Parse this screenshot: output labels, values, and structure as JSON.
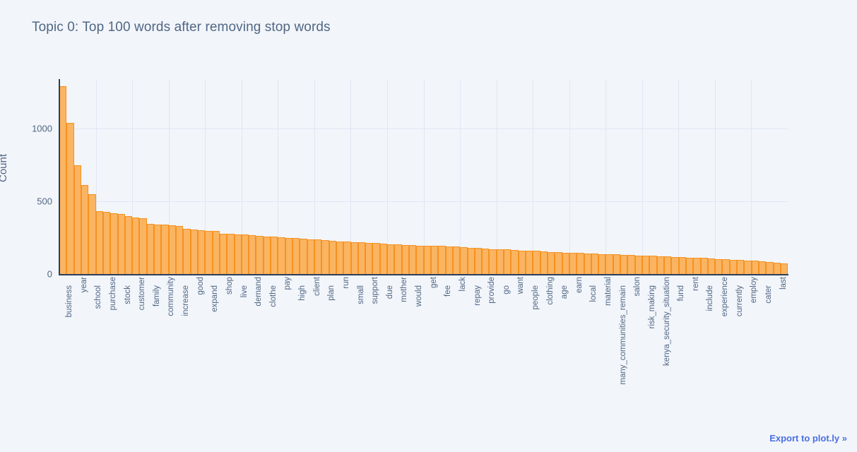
{
  "chart_data": {
    "type": "bar",
    "title": "Topic 0: Top 100 words after removing stop words",
    "xlabel": "",
    "ylabel": "Count",
    "ylim": [
      0,
      1340
    ],
    "yticks": [
      0,
      500,
      1000
    ],
    "ytick_labels": [
      "0",
      "500",
      "1000"
    ],
    "grid": true,
    "legend": null,
    "bar_color": "#FAB462",
    "bar_border_color": "#F5921F",
    "categories": [
      "business",
      "year",
      "school",
      "purchase",
      "stock",
      "customer",
      "family",
      "community",
      "increase",
      "good",
      "expand",
      "shop",
      "live",
      "demand",
      "clothe",
      "pay",
      "high",
      "client",
      "plan",
      "run",
      "small",
      "support",
      "due",
      "mother",
      "would",
      "get",
      "fee",
      "lack",
      "repay",
      "provide",
      "go",
      "want",
      "people",
      "clothing",
      "age",
      "earn",
      "local",
      "material",
      "many_communities_remain",
      "salon",
      "risk_making",
      "kenya_security_situation",
      "fund",
      "rent",
      "include",
      "experience",
      "currently",
      "employ",
      "cater",
      "last"
    ],
    "visible_tick_labels": [
      "business",
      "year",
      "school",
      "purchase",
      "stock",
      "customer",
      "family",
      "community",
      "increase",
      "good",
      "expand",
      "shop",
      "live",
      "demand",
      "clothe",
      "pay",
      "high",
      "client",
      "plan",
      "run",
      "small",
      "support",
      "due",
      "mother",
      "would",
      "get",
      "fee",
      "lack",
      "repay",
      "provide",
      "go",
      "want",
      "people",
      "clothing",
      "age",
      "earn",
      "local",
      "material",
      "many_communities_remain",
      "salon",
      "risk_making",
      "kenya_security_situation",
      "fund",
      "rent",
      "include",
      "experience",
      "currently",
      "employ",
      "cater",
      "last"
    ],
    "values": [
      1290,
      1040,
      750,
      610,
      550,
      430,
      425,
      420,
      415,
      400,
      390,
      385,
      345,
      340,
      340,
      335,
      330,
      310,
      305,
      300,
      298,
      295,
      278,
      275,
      272,
      270,
      268,
      262,
      258,
      255,
      252,
      250,
      248,
      245,
      240,
      238,
      235,
      230,
      225,
      222,
      220,
      218,
      215,
      212,
      208,
      205,
      202,
      200,
      198,
      196,
      195,
      193,
      192,
      190,
      188,
      186,
      182,
      178,
      175,
      172,
      170,
      168,
      165,
      162,
      160,
      158,
      155,
      152,
      150,
      148,
      146,
      144,
      142,
      140,
      138,
      136,
      134,
      132,
      130,
      128,
      126,
      124,
      122,
      120,
      118,
      116,
      114,
      112,
      110,
      108,
      104,
      100,
      98,
      95,
      92,
      90,
      86,
      82,
      78,
      75
    ],
    "n_bars": 100,
    "notes": "Every other category label is drawn; bars are unlabeled in between."
  },
  "footer": {
    "export_label": "Export to plot.ly »"
  }
}
